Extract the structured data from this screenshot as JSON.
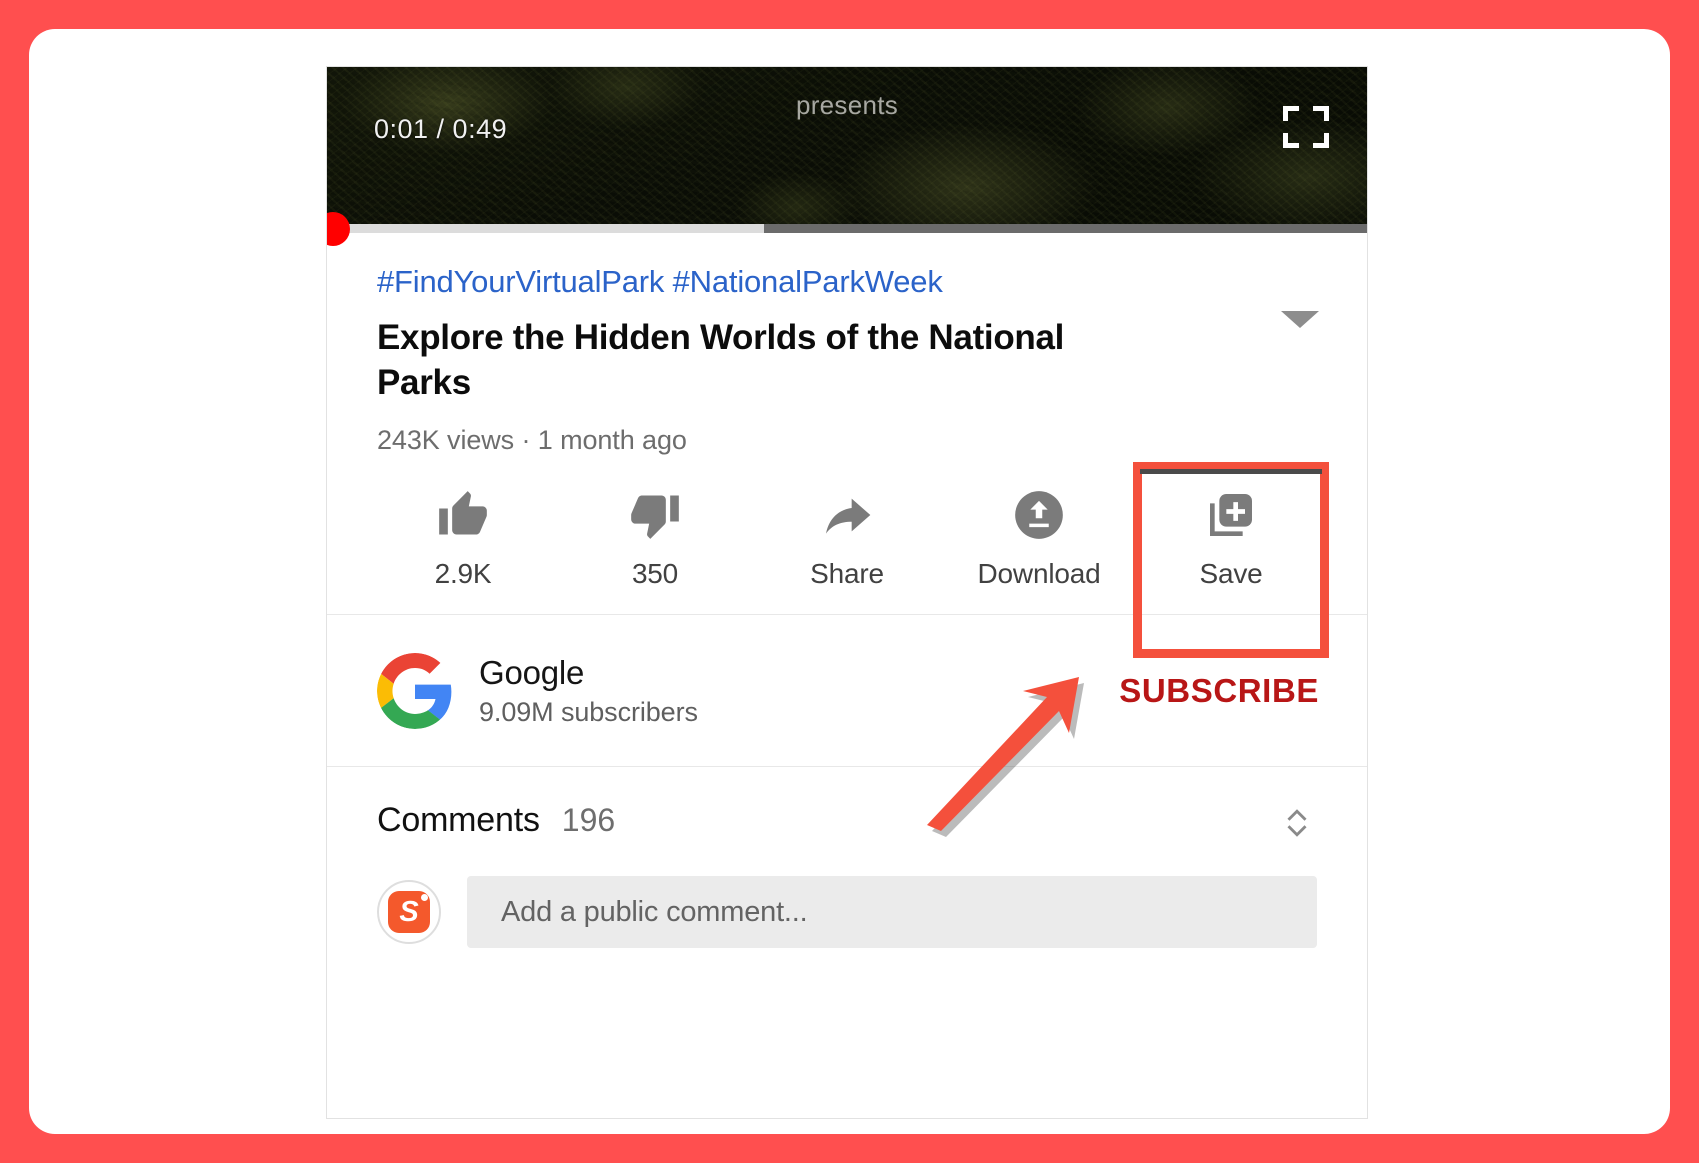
{
  "annotation": {
    "frame_color": "#ff4f4f",
    "arrow_color": "#f4503c",
    "highlight_color": "#f4503c",
    "arrow_name": "callout-arrow-to-save",
    "highlight_target": "Save"
  },
  "player": {
    "overlay_text": "presents",
    "time_current": "0:01",
    "time_separator": "/",
    "time_total": "0:49",
    "time_display": "0:01 / 0:49",
    "fullscreen_icon": "fullscreen-icon",
    "progress": {
      "played_percent": 0.4,
      "buffered_percent": 42,
      "scrubber_color": "#ff0000",
      "buffered_color": "#dcdcdc",
      "track_color": "#6b6b6b"
    }
  },
  "video": {
    "hashtags": "#FindYourVirtualPark #NationalParkWeek",
    "hashtag_color": "#2b63c9",
    "title": "Explore the Hidden Worlds of the National Parks",
    "stats": "243K views · 1 month ago",
    "expand_icon": "chevron-down-icon"
  },
  "actions": [
    {
      "label": "2.9K",
      "icon": "thumbs-up-icon",
      "name": "like-button"
    },
    {
      "label": "350",
      "icon": "thumbs-down-icon",
      "name": "dislike-button"
    },
    {
      "label": "Share",
      "icon": "share-arrow-icon",
      "name": "share-button"
    },
    {
      "label": "Download",
      "icon": "download-icon",
      "name": "download-button"
    },
    {
      "label": "Save",
      "icon": "save-playlist-icon",
      "name": "save-button"
    }
  ],
  "channel": {
    "name": "Google",
    "subscribers": "9.09M subscribers",
    "avatar_icon": "google-g-logo",
    "subscribe_label": "SUBSCRIBE",
    "subscribe_color": "#b81616"
  },
  "comments": {
    "title": "Comments",
    "count": "196",
    "sort_icon": "expand-collapse-icon",
    "compose_placeholder": "Add a public comment...",
    "user_avatar_letter": "S",
    "user_avatar_color": "#f4592c"
  }
}
